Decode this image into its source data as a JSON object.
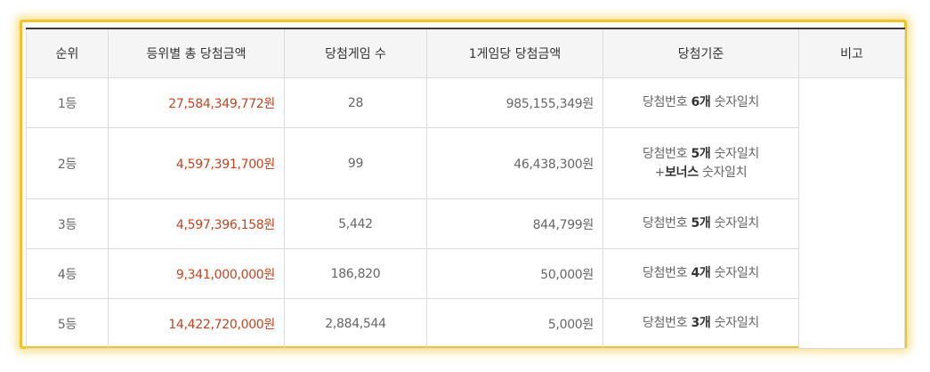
{
  "headers": {
    "rank": "순위",
    "total": "등위별 총 당첨금액",
    "games": "당첨게임 수",
    "per_game": "1게임당 당첨금액",
    "criteria": "당첨기준",
    "note": "비고"
  },
  "rows": [
    {
      "rank": "1등",
      "total": "27,584,349,772원",
      "games": "28",
      "per_game": "985,155,349원",
      "criteria": {
        "prefix": "당첨번호 ",
        "count": "6개",
        "suffix": " 숫자일치"
      }
    },
    {
      "rank": "2등",
      "total": "4,597,391,700원",
      "games": "99",
      "per_game": "46,438,300원",
      "criteria": {
        "prefix": "당첨번호 ",
        "count": "5개",
        "suffix": " 숫자일치",
        "extra_prefix": "+",
        "extra_bold": "보너스",
        "extra_suffix": " 숫자일치"
      }
    },
    {
      "rank": "3등",
      "total": "4,597,396,158원",
      "games": "5,442",
      "per_game": "844,799원",
      "criteria": {
        "prefix": "당첨번호 ",
        "count": "5개",
        "suffix": " 숫자일치"
      }
    },
    {
      "rank": "4등",
      "total": "9,341,000,000원",
      "games": "186,820",
      "per_game": "50,000원",
      "criteria": {
        "prefix": "당첨번호 ",
        "count": "4개",
        "suffix": " 숫자일치"
      }
    },
    {
      "rank": "5등",
      "total": "14,422,720,000원",
      "games": "2,884,544",
      "per_game": "5,000원",
      "criteria": {
        "prefix": "당첨번호 ",
        "count": "3개",
        "suffix": " 숫자일치"
      }
    }
  ],
  "colors": {
    "frame": "#f3c22a",
    "amount": "#c7421e",
    "header_bg": "#f5f5f5"
  }
}
